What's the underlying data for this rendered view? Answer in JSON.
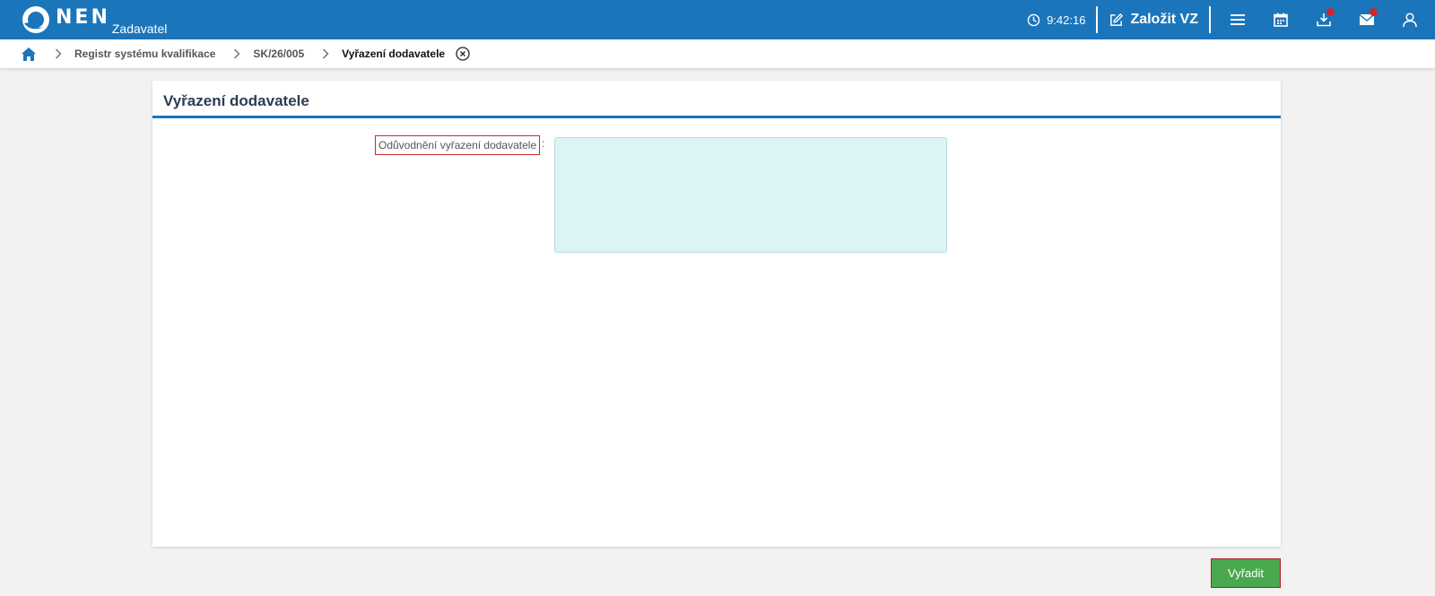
{
  "header": {
    "logo_text": "NEN",
    "logo_sub": "Zadavatel",
    "time": "9:42:16",
    "create_label": "Založit VZ",
    "icons": [
      "clock-icon",
      "edit-icon",
      "menu-icon",
      "calendar-icon",
      "download-icon",
      "mail-icon",
      "user-icon"
    ],
    "accent_color": "#1b75bb",
    "notification_color": "#d0262b"
  },
  "breadcrumb": {
    "items": [
      "Registr systému kvalifikace",
      "SK/26/005"
    ],
    "current": "Vyřazení dodavatele"
  },
  "panel": {
    "title": "Vyřazení dodavatele",
    "field_label": "Odůvodnění vyřazení dodavatele",
    "field_colon": ":",
    "field_value": ""
  },
  "actions": {
    "submit_label": "Vyřadit",
    "submit_color": "#4aa84f"
  }
}
